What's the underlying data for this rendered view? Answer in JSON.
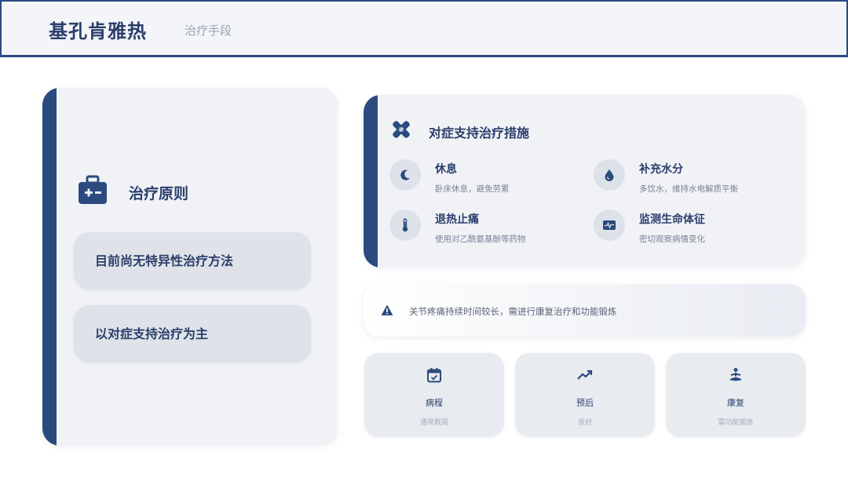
{
  "header": {
    "title": "基孔肯雅热",
    "subtitle": "治疗手段"
  },
  "principle": {
    "icon": "medical-kit-icon",
    "heading": "治疗原则",
    "points": [
      "目前尚无特异性治疗方法",
      "以对症支持治疗为主"
    ]
  },
  "measures": {
    "icon": "bandage-icon",
    "title": "对症支持治疗措施",
    "items": [
      {
        "icon": "moon-icon",
        "title": "休息",
        "desc": "卧床休息，避免劳累"
      },
      {
        "icon": "water-drop-icon",
        "title": "补充水分",
        "desc": "多饮水，维持水电解质平衡"
      },
      {
        "icon": "thermometer-icon",
        "title": "退热止痛",
        "desc": "使用对乙酰氨基酚等药物"
      },
      {
        "icon": "heart-monitor-icon",
        "title": "监测生命体征",
        "desc": "密切观察病情变化"
      }
    ]
  },
  "warning": {
    "icon": "warning-icon",
    "text": "关节疼痛持续时间较长，需进行康复治疗和功能锻炼"
  },
  "stats": [
    {
      "icon": "calendar-check-icon",
      "label": "病程",
      "desc": "通常数周"
    },
    {
      "icon": "trend-up-icon",
      "label": "预后",
      "desc": "良好"
    },
    {
      "icon": "meditation-icon",
      "label": "康复",
      "desc": "需功能锻炼"
    }
  ],
  "colors": {
    "primary": "#2b4a7e",
    "card": "#f0f2f6",
    "pill": "#dfe3e9",
    "text": "#2a3e6a"
  }
}
